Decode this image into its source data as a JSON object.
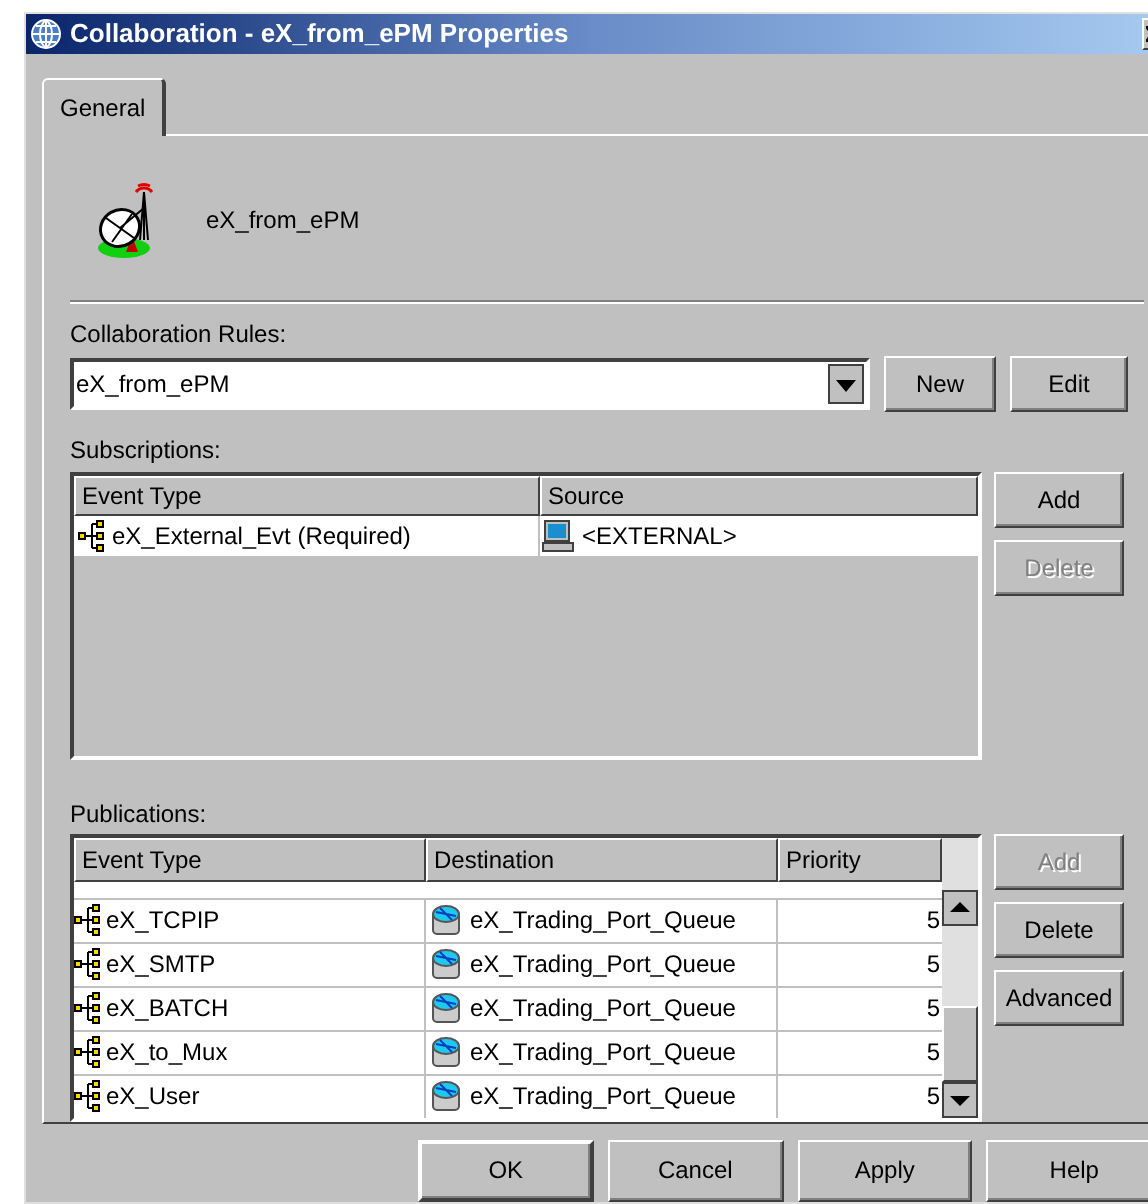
{
  "window": {
    "title": "Collaboration - eX_from_ePM Properties"
  },
  "tabs": [
    {
      "label": "General",
      "selected": true
    }
  ],
  "header": {
    "name": "eX_from_ePM"
  },
  "rules": {
    "label": "Collaboration Rules:",
    "value": "eX_from_ePM",
    "buttons": [
      {
        "label": "New",
        "disabled": false
      },
      {
        "label": "Edit",
        "disabled": false
      }
    ]
  },
  "subscriptions": {
    "label": "Subscriptions:",
    "columns": [
      "Event Type",
      "Source"
    ],
    "rows": [
      {
        "event": "eX_External_Evt (Required)",
        "source": "<EXTERNAL>"
      }
    ],
    "buttons": [
      {
        "label": "Add",
        "disabled": false
      },
      {
        "label": "Delete",
        "disabled": true
      }
    ]
  },
  "publications": {
    "label": "Publications:",
    "columns": [
      "Event Type",
      "Destination",
      "Priority"
    ],
    "rows": [
      {
        "event": "eX_TCPIP",
        "destination": "eX_Trading_Port_Queue",
        "priority": "5"
      },
      {
        "event": "eX_SMTP",
        "destination": "eX_Trading_Port_Queue",
        "priority": "5"
      },
      {
        "event": "eX_BATCH",
        "destination": "eX_Trading_Port_Queue",
        "priority": "5"
      },
      {
        "event": "eX_to_Mux",
        "destination": "eX_Trading_Port_Queue",
        "priority": "5"
      },
      {
        "event": "eX_User",
        "destination": "eX_Trading_Port_Queue",
        "priority": "5"
      }
    ],
    "buttons": [
      {
        "label": "Add",
        "disabled": true
      },
      {
        "label": "Delete",
        "disabled": false
      },
      {
        "label": "Advanced",
        "disabled": false
      }
    ]
  },
  "footer": [
    {
      "label": "OK",
      "default": true
    },
    {
      "label": "Cancel",
      "default": false
    },
    {
      "label": "Apply",
      "default": false
    },
    {
      "label": "Help",
      "default": false
    }
  ]
}
